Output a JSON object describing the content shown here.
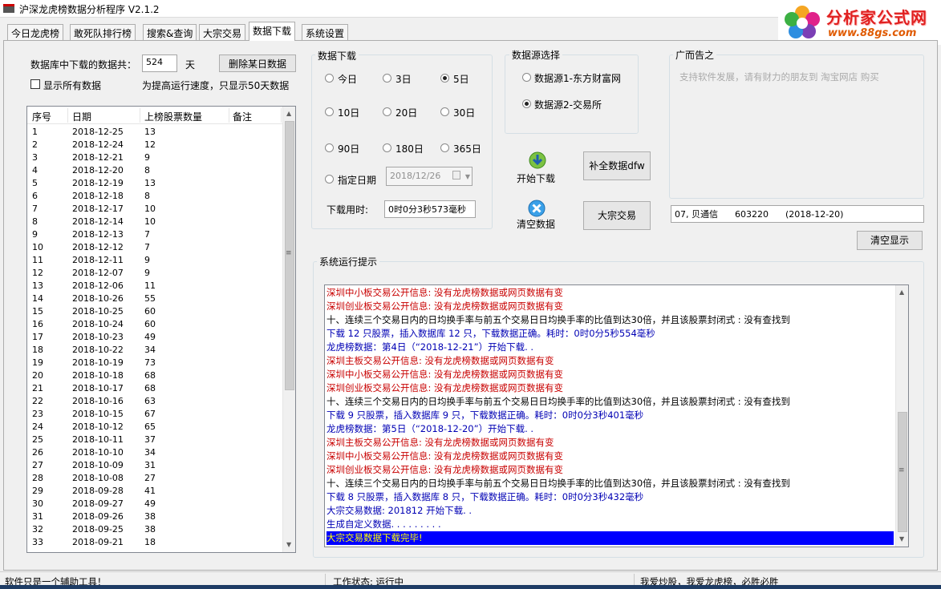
{
  "window": {
    "title": "沪深龙虎榜数据分析程序 V2.1.2"
  },
  "logo": {
    "line1": "分析家公式网",
    "line2": "www.88gs.com"
  },
  "tabs": [
    {
      "label": "今日龙虎榜",
      "active": false
    },
    {
      "label": "敢死队排行榜",
      "active": false
    },
    {
      "label": "搜索&查询",
      "active": false
    },
    {
      "label": "大宗交易",
      "active": false
    },
    {
      "label": "数据下载",
      "active": true
    },
    {
      "label": "系统设置",
      "active": false
    }
  ],
  "left": {
    "db_label": "数据库中下载的数据共：",
    "db_count": "524",
    "db_unit": "天",
    "delete_button": "删除某日数据",
    "show_all_label": "显示所有数据",
    "show_all_checked": false,
    "speed_note": "为提高运行速度，只显示50天数据",
    "columns": [
      "序号",
      "日期",
      "上榜股票数量",
      "备注"
    ],
    "rows": [
      [
        "1",
        "2018-12-25",
        "13",
        ""
      ],
      [
        "2",
        "2018-12-24",
        "12",
        ""
      ],
      [
        "3",
        "2018-12-21",
        "9",
        ""
      ],
      [
        "4",
        "2018-12-20",
        "8",
        ""
      ],
      [
        "5",
        "2018-12-19",
        "13",
        ""
      ],
      [
        "6",
        "2018-12-18",
        "8",
        ""
      ],
      [
        "7",
        "2018-12-17",
        "10",
        ""
      ],
      [
        "8",
        "2018-12-14",
        "10",
        ""
      ],
      [
        "9",
        "2018-12-13",
        "7",
        ""
      ],
      [
        "10",
        "2018-12-12",
        "7",
        ""
      ],
      [
        "11",
        "2018-12-11",
        "9",
        ""
      ],
      [
        "12",
        "2018-12-07",
        "9",
        ""
      ],
      [
        "13",
        "2018-12-06",
        "11",
        ""
      ],
      [
        "14",
        "2018-10-26",
        "55",
        ""
      ],
      [
        "15",
        "2018-10-25",
        "60",
        ""
      ],
      [
        "16",
        "2018-10-24",
        "60",
        ""
      ],
      [
        "17",
        "2018-10-23",
        "49",
        ""
      ],
      [
        "18",
        "2018-10-22",
        "34",
        ""
      ],
      [
        "19",
        "2018-10-19",
        "73",
        ""
      ],
      [
        "20",
        "2018-10-18",
        "68",
        ""
      ],
      [
        "21",
        "2018-10-17",
        "68",
        ""
      ],
      [
        "22",
        "2018-10-16",
        "63",
        ""
      ],
      [
        "23",
        "2018-10-15",
        "67",
        ""
      ],
      [
        "24",
        "2018-10-12",
        "65",
        ""
      ],
      [
        "25",
        "2018-10-11",
        "37",
        ""
      ],
      [
        "26",
        "2018-10-10",
        "34",
        ""
      ],
      [
        "27",
        "2018-10-09",
        "31",
        ""
      ],
      [
        "28",
        "2018-10-08",
        "27",
        ""
      ],
      [
        "29",
        "2018-09-28",
        "41",
        ""
      ],
      [
        "30",
        "2018-09-27",
        "49",
        ""
      ],
      [
        "31",
        "2018-09-26",
        "38",
        ""
      ],
      [
        "32",
        "2018-09-25",
        "38",
        ""
      ],
      [
        "33",
        "2018-09-21",
        "18",
        ""
      ]
    ]
  },
  "download": {
    "legend": "数据下载",
    "options": [
      {
        "label": "今日",
        "checked": false
      },
      {
        "label": "3日",
        "checked": false
      },
      {
        "label": "5日",
        "checked": true
      },
      {
        "label": "10日",
        "checked": false
      },
      {
        "label": "20日",
        "checked": false
      },
      {
        "label": "30日",
        "checked": false
      },
      {
        "label": "90日",
        "checked": false
      },
      {
        "label": "180日",
        "checked": false
      },
      {
        "label": "365日",
        "checked": false
      }
    ],
    "specify_label": "指定日期",
    "date_value": "2018/12/26",
    "elapsed_label": "下载用时:",
    "elapsed_value": "0时0分3秒573毫秒"
  },
  "source": {
    "legend": "数据源选择",
    "options": [
      {
        "label": "数据源1-东方财富网",
        "checked": false
      },
      {
        "label": "数据源2-交易所",
        "checked": true
      }
    ]
  },
  "actions": {
    "start_download": "开始下载",
    "clear_data": "清空数据",
    "fill_data": "补全数据dfw",
    "block_trade": "大宗交易"
  },
  "ad": {
    "legend": "广而告之",
    "text": "支持软件发展，请有财力的朋友到 淘宝网店 购买",
    "info_field": "07, 贝通信      603220      (2018-12-20)",
    "clear_display": "清空显示"
  },
  "log": {
    "legend": "系统运行提示",
    "lines": [
      {
        "text": "深圳中小板交易公开信息: 没有龙虎榜数据或网页数据有变",
        "color": "red"
      },
      {
        "text": "深圳创业板交易公开信息: 没有龙虎榜数据或网页数据有变",
        "color": "red"
      },
      {
        "text": "十、连续三个交易日内的日均换手率与前五个交易日日均换手率的比值到达30倍，并且该股票封闭式 : 没有查找到",
        "color": "black"
      },
      {
        "text": "下载 12 只股票，插入数据库 12 只，下载数据正确。耗时：0时0分5秒554毫秒",
        "color": "blue"
      },
      {
        "text": "龙虎榜数据：第4日（“2018-12-21”）开始下载. .",
        "color": "blue"
      },
      {
        "text": "深圳主板交易公开信息: 没有龙虎榜数据或网页数据有变",
        "color": "red"
      },
      {
        "text": "深圳中小板交易公开信息: 没有龙虎榜数据或网页数据有变",
        "color": "red"
      },
      {
        "text": "深圳创业板交易公开信息: 没有龙虎榜数据或网页数据有变",
        "color": "red"
      },
      {
        "text": "十、连续三个交易日内的日均换手率与前五个交易日日均换手率的比值到达30倍，并且该股票封闭式 : 没有查找到",
        "color": "black"
      },
      {
        "text": "下载 9 只股票，插入数据库 9 只，下载数据正确。耗时：0时0分3秒401毫秒",
        "color": "blue"
      },
      {
        "text": "龙虎榜数据：第5日（“2018-12-20”）开始下载. .",
        "color": "blue"
      },
      {
        "text": "深圳主板交易公开信息: 没有龙虎榜数据或网页数据有变",
        "color": "red"
      },
      {
        "text": "深圳中小板交易公开信息: 没有龙虎榜数据或网页数据有变",
        "color": "red"
      },
      {
        "text": "深圳创业板交易公开信息: 没有龙虎榜数据或网页数据有变",
        "color": "red"
      },
      {
        "text": "十、连续三个交易日内的日均换手率与前五个交易日日均换手率的比值到达30倍，并且该股票封闭式 : 没有查找到",
        "color": "black"
      },
      {
        "text": "下载 8 只股票，插入数据库 8 只，下载数据正确。耗时：0时0分3秒432毫秒",
        "color": "blue"
      },
      {
        "text": "大宗交易数据: 201812 开始下载. .",
        "color": "blue"
      },
      {
        "text": "生成自定义数据. . . . . . . . .",
        "color": "blue"
      },
      {
        "text": "大宗交易数据下载完毕!",
        "color": "highlight"
      }
    ]
  },
  "status": {
    "left": "软件只是一个辅助工具！",
    "middle": "工作状态: 运行中",
    "right": "我爱炒股，我爱龙虎榜，必胜必胜"
  },
  "colors": {
    "log_red": "#c80000",
    "log_blue": "#0000b4",
    "highlight_bg": "#0000ff",
    "highlight_fg": "#ffff00",
    "logo_red": "#e02020"
  }
}
